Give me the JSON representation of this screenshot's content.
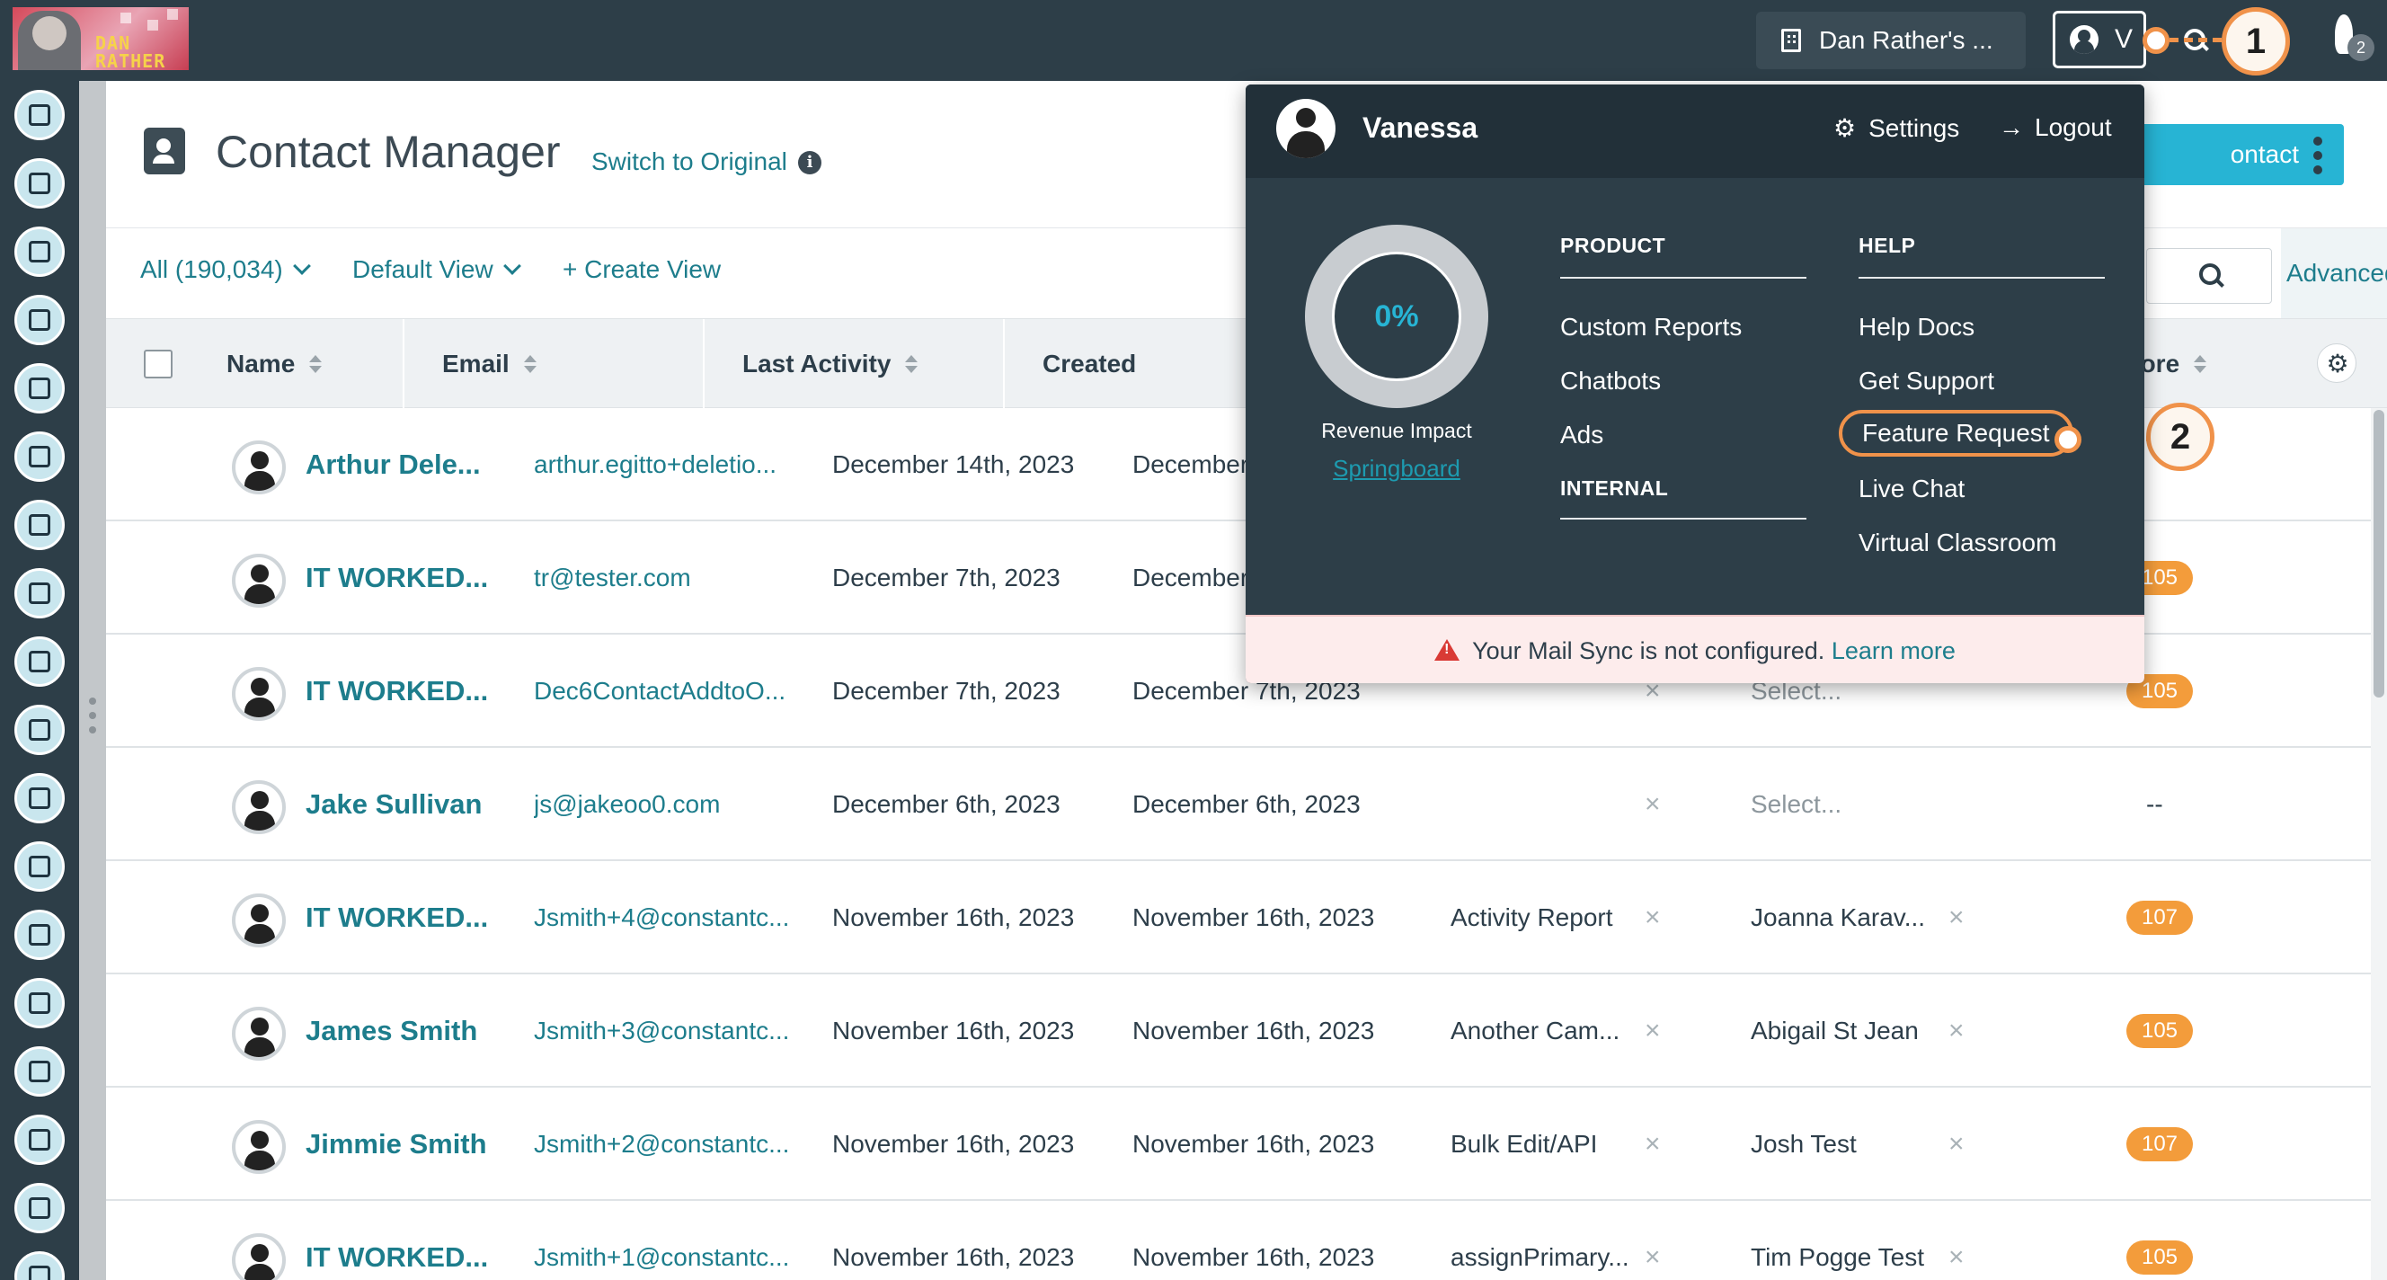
{
  "topbar": {
    "brand_logo_text": "DAN RATHER",
    "account_name": "Dan Rather's ...",
    "user_initial": "V",
    "notification_count": "2"
  },
  "callouts": [
    "1",
    "2"
  ],
  "sidebar": {
    "icons": [
      "contacts-icon",
      "inbox-icon",
      "clipboard-icon",
      "map-icon",
      "branch-icon",
      "list-icon",
      "megaphone-icon",
      "chat-icon",
      "thumbs-up-icon",
      "tv-icon",
      "image-icon",
      "calendar-icon",
      "handshake-icon",
      "chart-icon",
      "headset-icon",
      "user-star-icon",
      "bar-chart-icon",
      "building-icon"
    ]
  },
  "header": {
    "title": "Contact Manager",
    "switch_link": "Switch to Original",
    "add_button": "ontact"
  },
  "filters": {
    "all_label": "All (190,034)",
    "view_label": "Default View",
    "create_view": "+ Create View",
    "advanced": "Advanced"
  },
  "table": {
    "columns": [
      "Name",
      "Email",
      "Last Activity",
      "Created",
      "core"
    ],
    "rows": [
      {
        "name": "Arthur Dele...",
        "email": "arthur.egitto+deletio...",
        "last_activity": "December 14th, 2023",
        "created": "December",
        "campaign": "",
        "owner": "",
        "score": ""
      },
      {
        "name": "IT WORKED...",
        "email": "tr@tester.com",
        "last_activity": "December 7th, 2023",
        "created": "December",
        "campaign": "",
        "owner": "",
        "score": "105"
      },
      {
        "name": "IT WORKED...",
        "email": "Dec6ContactAddtoO...",
        "last_activity": "December 7th, 2023",
        "created": "December 7th, 2023",
        "campaign": "",
        "owner": "Select...",
        "score": "105"
      },
      {
        "name": "Jake Sullivan",
        "email": "js@jakeoo0.com",
        "last_activity": "December 6th, 2023",
        "created": "December 6th, 2023",
        "campaign": "",
        "owner": "Select...",
        "score": "--"
      },
      {
        "name": "IT WORKED...",
        "email": "Jsmith+4@constantc...",
        "last_activity": "November 16th, 2023",
        "created": "November 16th, 2023",
        "campaign": "Activity Report",
        "owner": "Joanna Karav...",
        "score": "107"
      },
      {
        "name": "James Smith",
        "email": "Jsmith+3@constantc...",
        "last_activity": "November 16th, 2023",
        "created": "November 16th, 2023",
        "campaign": "Another Cam...",
        "owner": "Abigail St Jean",
        "score": "105"
      },
      {
        "name": "Jimmie Smith",
        "email": "Jsmith+2@constantc...",
        "last_activity": "November 16th, 2023",
        "created": "November 16th, 2023",
        "campaign": "Bulk Edit/API",
        "owner": "Josh Test",
        "score": "107"
      },
      {
        "name": "IT WORKED...",
        "email": "Jsmith+1@constantc...",
        "last_activity": "November 16th, 2023",
        "created": "November 16th, 2023",
        "campaign": "assignPrimary...",
        "owner": "Tim Pogge Test",
        "score": "105"
      }
    ]
  },
  "dropdown": {
    "user_name": "Vanessa",
    "settings": "Settings",
    "logout": "Logout",
    "revenue_percent": "0%",
    "revenue_label": "Revenue Impact",
    "springboard": "Springboard",
    "product_heading": "PRODUCT",
    "product_items": [
      "Custom Reports",
      "Chatbots",
      "Ads"
    ],
    "internal_heading": "INTERNAL",
    "help_heading": "HELP",
    "help_items": [
      "Help Docs",
      "Get Support",
      "Feature Request",
      "Live Chat",
      "Virtual Classroom"
    ],
    "warning_text": "Your Mail Sync is not configured.",
    "warning_link": "Learn more"
  },
  "colors": {
    "topbar": "#2d3e48",
    "accent": "#1d7d8c",
    "primary_button": "#27b4d4",
    "score": "#f39c3b",
    "callout": "#f0924a"
  }
}
